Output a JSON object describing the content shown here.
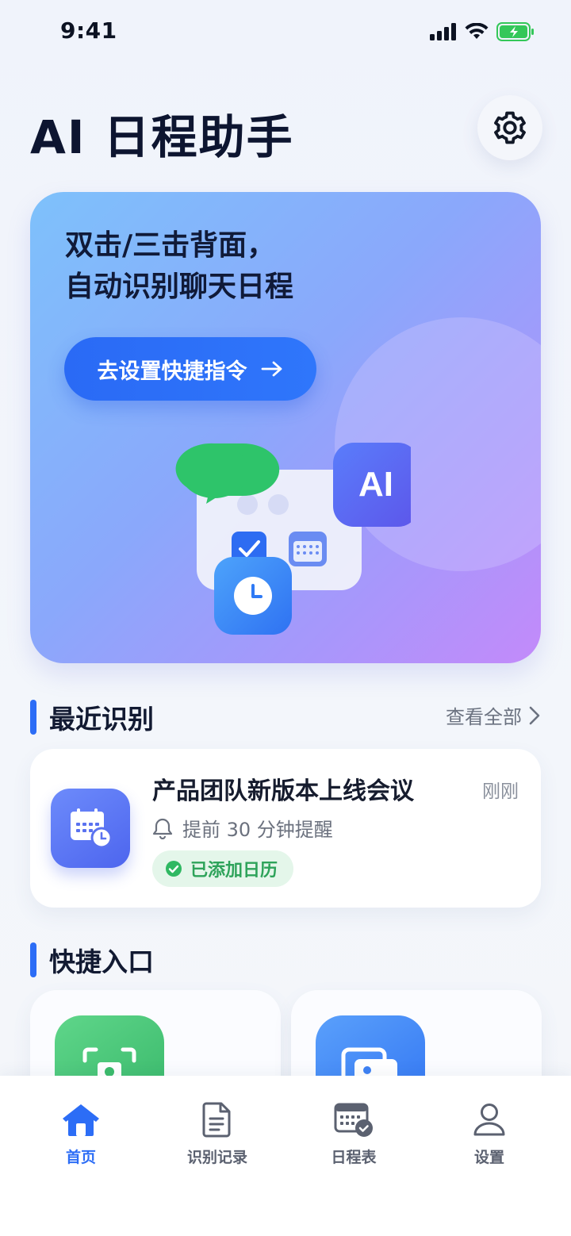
{
  "status_bar": {
    "time": "9:41"
  },
  "header": {
    "title": "AI 日程助手"
  },
  "hero": {
    "line1": "双击/三击背面，",
    "line2": "自动识别聊天日程",
    "cta_label": "去设置快捷指令",
    "ai_badge": "AI"
  },
  "recent": {
    "section_title": "最近识别",
    "view_all": "查看全部",
    "item": {
      "title": "产品团队新版本上线会议",
      "time": "刚刚",
      "reminder": "提前 30 分钟提醒",
      "status": "已添加日历"
    }
  },
  "shortcuts": {
    "section_title": "快捷入口"
  },
  "tab_bar": {
    "tabs": [
      {
        "label": "首页",
        "icon": "home-icon",
        "active": true
      },
      {
        "label": "识别记录",
        "icon": "document-icon",
        "active": false
      },
      {
        "label": "日程表",
        "icon": "calendar-check-icon",
        "active": false
      },
      {
        "label": "设置",
        "icon": "user-icon",
        "active": false
      }
    ]
  },
  "colors": {
    "accent": "#2C6DF6",
    "success": "#2EA35A",
    "title": "#0D1530"
  }
}
